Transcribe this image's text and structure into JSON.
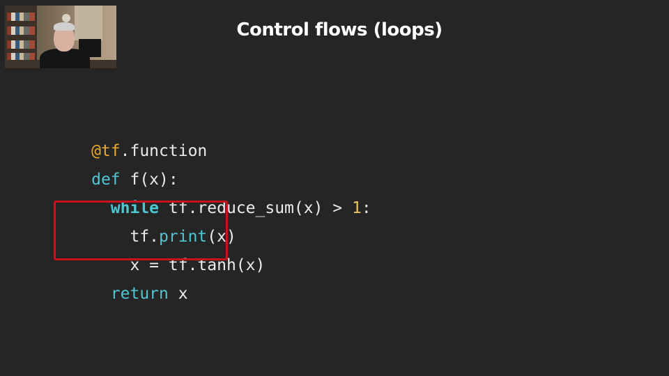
{
  "slide": {
    "title": "Control flows (loops)"
  },
  "code": {
    "lines": [
      {
        "indent": "",
        "tokens": [
          {
            "text": "@tf",
            "kind": "deco"
          },
          {
            "text": ".function",
            "kind": "plain"
          }
        ]
      },
      {
        "indent": "",
        "tokens": [
          {
            "text": "def",
            "kind": "kw"
          },
          {
            "text": " f(x):",
            "kind": "plain"
          }
        ]
      },
      {
        "indent": "  ",
        "tokens": [
          {
            "text": "while",
            "kind": "kwb"
          },
          {
            "text": " tf.reduce_sum(x) > ",
            "kind": "plain"
          },
          {
            "text": "1",
            "kind": "num"
          },
          {
            "text": ":",
            "kind": "plain"
          }
        ]
      },
      {
        "indent": "    ",
        "tokens": [
          {
            "text": "tf.",
            "kind": "plain"
          },
          {
            "text": "print",
            "kind": "kw"
          },
          {
            "text": "(x)",
            "kind": "plain"
          }
        ]
      },
      {
        "indent": "    ",
        "tokens": [
          {
            "text": "x = tf.tanh(x)",
            "kind": "plain"
          }
        ]
      },
      {
        "indent": "  ",
        "tokens": [
          {
            "text": "return",
            "kind": "kw"
          },
          {
            "text": " x",
            "kind": "plain"
          }
        ]
      }
    ]
  },
  "colors": {
    "background": "#252525",
    "keyword": "#4fc7d3",
    "decorator": "#e8a82e",
    "number": "#e8c36a",
    "highlight_border": "#c8121d"
  }
}
